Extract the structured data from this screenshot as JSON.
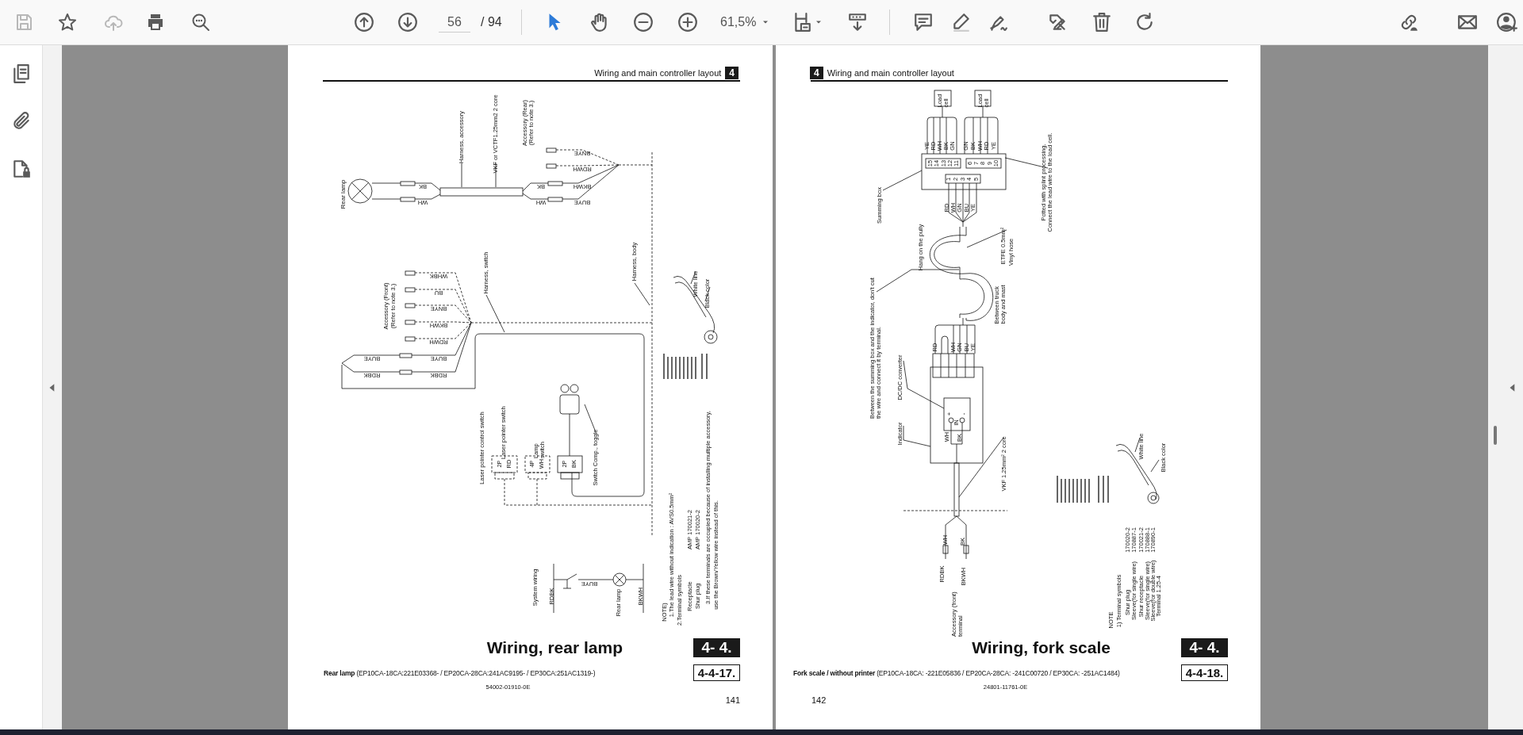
{
  "toolbar": {
    "file_actions": [
      {
        "disabled": true
      },
      {
        "disabled": false
      },
      {
        "disabled": true
      },
      {
        "disabled": false
      },
      {
        "disabled": false
      }
    ],
    "page_current": "56",
    "page_total": "/ 94",
    "tools": [
      {
        "selected": true
      },
      {
        "selected": false
      }
    ],
    "zoom": "61,5%"
  },
  "pages": [
    {
      "header_number": "4",
      "header_title": "Wiring and main controller layout",
      "labels": [
        "Rear lamp",
        "Harness, accessory",
        "VKF or VCTF1.25mm2 2 core",
        "Accessory (Rear)",
        "(Refer to note 3.)",
        "BK",
        "WH",
        "BK",
        "WH",
        "BNYE",
        "RDWH",
        "BKWH",
        "BUYE",
        "Accessory (Front)",
        "(Refer to note 3.)",
        "WHBK",
        "BU",
        "BNYE",
        "BKWH",
        "RDWH",
        "BUYE",
        "RDBK",
        "BUYE",
        "RDBK",
        "Harness, switch",
        "Harness, body",
        "Laser pointer control switch",
        "Laser pointer switch",
        "Lamp switch",
        "2P",
        "BK",
        "4P",
        "WH",
        "2P",
        "RD",
        "Switch Comp., toggle",
        "White line",
        "Black color",
        "System wiring",
        "RDBK",
        "BUYE",
        "Rear lamp",
        "BKWH",
        "NOTE)",
        "1.The lead wire without indication : AVS0.5mm²",
        "2.Terminal symbols",
        "Receptacle",
        "AMP 170021-2",
        "Shur plug",
        "AMP 170020-2",
        "3.If these terminals are occupied because of installing multiple accessory,",
        "use the Brown/Yellow wire instead of this."
      ],
      "title": "Wiring, rear lamp",
      "section_badge": "4- 4.",
      "subtitle": "**Rear lamp** (EP10CA-18CA:221E03368- / EP20CA-28CA:241AC9195- / EP30CA:251AC1319-)",
      "figure_number": "4-4-17.",
      "doc_code": "54002-01910-0E",
      "page_number": "141"
    },
    {
      "header_number": "4",
      "header_title": "Wiring and main controller layout",
      "labels": [
        "Load cell",
        "Load cell",
        "YE",
        "RD",
        "WH",
        "BK",
        "GN",
        "GN",
        "BK",
        "WH",
        "RD",
        "YE",
        "15",
        "14",
        "13",
        "12",
        "11",
        "6",
        "7",
        "8",
        "9",
        "10",
        "1",
        "2",
        "3",
        "4",
        "5",
        "RD",
        "WH",
        "GN",
        "BU",
        "YE",
        "Summing box",
        "Potted with splint processing.",
        "Connect the lead wire to the load cell.",
        "Hang on the pully",
        "ETFE 0.5mm²",
        "Vinyl hose",
        "Between truck body and mast",
        "Between the summing box and the indicator, don't cut the wire and connect it by terminal.",
        "RD",
        "WH",
        "GN",
        "BU",
        "YE",
        "DC/DC converter",
        "Indicator",
        "+",
        "IN",
        "-",
        "WH",
        "BK",
        "VKF 1.25mm² 2 core",
        "WH",
        "BK",
        "RDBK",
        "BKWH",
        "Accessory (front) terminal",
        "White line",
        "Black color",
        "NOTE",
        "1) Terminal symbols",
        "Shur plug",
        "170020-2",
        "Sleeve(for single wire)",
        "170887-1",
        "Shur receptacle",
        "170021-2",
        "Sleeve(for single wire)",
        "170888-1",
        "Sleeve(for double wire)",
        "170890-1",
        "Terminal 1.25-4"
      ],
      "title": "Wiring, fork scale",
      "section_badge": "4- 4.",
      "subtitle": "**Fork scale / without printer** (EP10CA-18CA: -221E05836 / EP20CA-28CA: -241C00720 / EP30CA: -251AC1484)",
      "figure_number": "4-4-18.",
      "doc_code": "24801-11761-0E",
      "page_number": "142"
    }
  ]
}
